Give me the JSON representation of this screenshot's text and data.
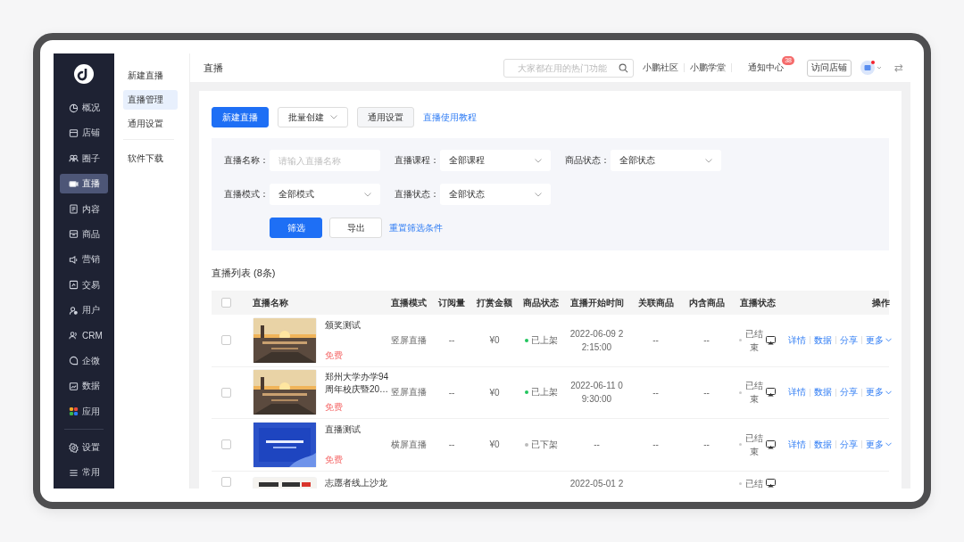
{
  "sidebar": {
    "items": [
      {
        "label": "概况",
        "selected": false
      },
      {
        "label": "店铺",
        "selected": false
      },
      {
        "label": "圈子",
        "selected": false
      },
      {
        "label": "直播",
        "selected": true
      },
      {
        "label": "内容",
        "selected": false
      },
      {
        "label": "商品",
        "selected": false
      },
      {
        "label": "营销",
        "selected": false
      },
      {
        "label": "交易",
        "selected": false
      },
      {
        "label": "用户",
        "selected": false
      },
      {
        "label": "CRM",
        "selected": false
      },
      {
        "label": "企微",
        "selected": false
      },
      {
        "label": "数据",
        "selected": false
      },
      {
        "label": "应用",
        "selected": false
      }
    ],
    "bottom_items": [
      {
        "label": "设置",
        "selected": false
      },
      {
        "label": "常用",
        "selected": false
      }
    ]
  },
  "submenu": {
    "items": [
      {
        "label": "新建直播",
        "selected": false
      },
      {
        "label": "直播管理",
        "selected": true
      },
      {
        "label": "通用设置",
        "selected": false
      }
    ],
    "extra_items": [
      {
        "label": "软件下载",
        "selected": false
      }
    ]
  },
  "header": {
    "title": "直播",
    "search": {
      "placeholder": "大家都在用的热门功能"
    },
    "links": [
      "小鹏社区",
      "小鹏学堂"
    ],
    "notice": {
      "label": "通知中心",
      "badge": "38"
    },
    "visit_button": "访问店铺",
    "swap": "⇄"
  },
  "toolbar": {
    "primary": "新建直播",
    "batch": "批量创建",
    "settings": "通用设置",
    "link": "直播使用教程"
  },
  "filters": [
    {
      "label": "直播名称：",
      "kind": "input",
      "placeholder": "请输入直播名称"
    },
    {
      "label": "直播课程：",
      "kind": "select",
      "value": "全部课程"
    },
    {
      "label": "商品状态：",
      "kind": "select",
      "value": "全部状态"
    },
    {
      "label": "直播模式：",
      "kind": "select",
      "value": "全部模式"
    },
    {
      "label": "直播状态：",
      "kind": "select",
      "value": "全部状态"
    }
  ],
  "filter_buttons": {
    "apply": "筛选",
    "export": "导出",
    "reset": "重置筛选条件"
  },
  "list": {
    "title": "直播列表 (8条)",
    "select_all_checked": false,
    "columns": [
      "直播名称",
      "直播模式",
      "订阅量",
      "打赏金额",
      "商品状态",
      "直播开始时间",
      "关联商品",
      "内含商品",
      "直播状态",
      "操作"
    ],
    "rows": [
      {
        "kind": "full",
        "checked": false,
        "name": "颁奖测试",
        "price": "免费",
        "mode": "竖屏直播",
        "subs": "--",
        "tips": "¥0",
        "goods_status": "已上架",
        "listed": true,
        "start": "2022-06-09 22:15:00",
        "related": "--",
        "included": "--",
        "live_status": "已结束",
        "actions": [
          "详情",
          "数据",
          "分享",
          "更多"
        ]
      },
      {
        "kind": "full",
        "checked": false,
        "name": "郑州大学办学94周年校庆暨20…",
        "price": "免费",
        "mode": "竖屏直播",
        "subs": "--",
        "tips": "¥0",
        "goods_status": "已上架",
        "listed": true,
        "start": "2022-06-11 09:30:00",
        "related": "--",
        "included": "--",
        "live_status": "已结束",
        "actions": [
          "详情",
          "数据",
          "分享",
          "更多"
        ]
      },
      {
        "kind": "full",
        "checked": false,
        "name": "直播测试",
        "price": "免费",
        "mode": "横屏直播",
        "subs": "--",
        "tips": "¥0",
        "goods_status": "已下架",
        "listed": false,
        "start": "--",
        "related": "--",
        "included": "--",
        "live_status": "已结束",
        "actions": [
          "详情",
          "数据",
          "分享",
          "更多"
        ]
      },
      {
        "kind": "cut",
        "checked": false,
        "name": "志愿者线上沙龙",
        "start": "2022-05-01 2",
        "live_status": "已结"
      }
    ]
  }
}
